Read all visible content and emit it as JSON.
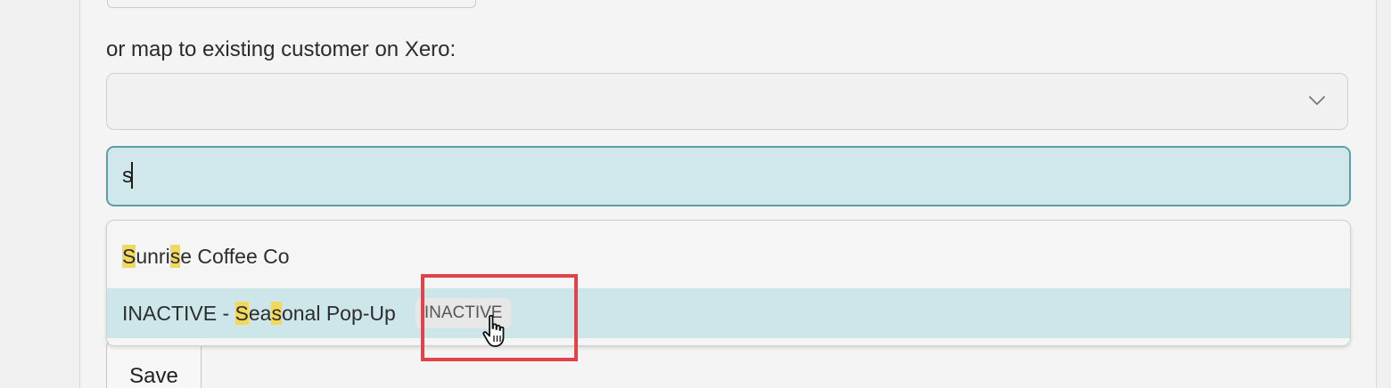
{
  "form": {
    "map_label": "or map to existing customer on Xero:",
    "select_value": "",
    "search_value": "s",
    "save_label": "Save"
  },
  "dropdown": {
    "options": [
      {
        "segments": [
          {
            "text": "S",
            "match": true
          },
          {
            "text": "unri",
            "match": false
          },
          {
            "text": "s",
            "match": true
          },
          {
            "text": "e Coffee Co",
            "match": false
          }
        ]
      },
      {
        "segments": [
          {
            "text": "INACTIVE - ",
            "match": false
          },
          {
            "text": "S",
            "match": true
          },
          {
            "text": "ea",
            "match": false
          },
          {
            "text": "s",
            "match": true
          },
          {
            "text": "onal Pop-Up",
            "match": false
          }
        ],
        "badge": "INACTIVE",
        "active": true
      }
    ]
  },
  "colors": {
    "highlight_match": "#f3d95b",
    "active_option_bg": "#cde6ea",
    "search_bg": "#d0e8eb",
    "annotation_frame": "#e0434a"
  },
  "icons": {
    "select_chevron": "chevron-down-icon",
    "pointer": "hand-pointer-icon"
  }
}
